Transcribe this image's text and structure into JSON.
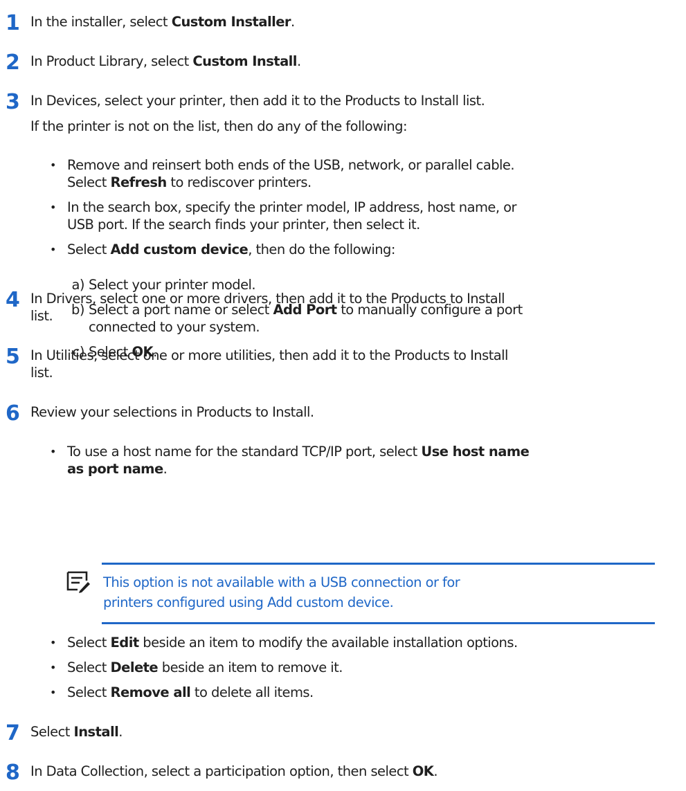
{
  "steps": [
    {
      "number": "1",
      "text": [
        "In the installer, select ",
        "Custom Installer",
        "."
      ]
    },
    {
      "number": "2",
      "text": [
        "In Product Library, select ",
        "Custom Install",
        "."
      ]
    },
    {
      "number": "3",
      "line1": "In Devices, select your printer, then add it to the Products to Install list.",
      "line2": "If the printer is not on the list, then do any of the following:",
      "bullets": [
        {
          "l1": "Remove and reinsert both ends of the USB, network, or parallel cable.",
          "l2": [
            "Select ",
            "Refresh",
            " to rediscover printers."
          ]
        },
        {
          "l1": "In the search box, specify the printer model, IP address, host name, or",
          "l2": "USB port. If the search finds your printer, then select it."
        },
        {
          "l1": [
            "Select ",
            "Add custom device",
            ", then do the following:"
          ]
        }
      ],
      "substeps": [
        {
          "label": "a)",
          "text": "Select your printer model."
        },
        {
          "label": "b)",
          "l1": [
            "Select a port name or select ",
            "Add Port",
            " to manually configure a port"
          ],
          "l2": "connected to your system."
        },
        {
          "label": "c)",
          "text": [
            "Select ",
            "OK",
            "."
          ]
        }
      ]
    },
    {
      "number": "4",
      "l1": "In Drivers, select one or more drivers, then add it to the Products to Install",
      "l2": "list."
    },
    {
      "number": "5",
      "l1": "In Utilities, select one or more utilities, then add it to the Products to Install",
      "l2": "list."
    },
    {
      "number": "6",
      "text": "Review your selections in Products to Install.",
      "bullets": [
        {
          "l1": [
            "To use a host name for the standard TCP/IP port, select ",
            "Use host name"
          ],
          "l2": [
            "as port name",
            "."
          ]
        },
        {
          "l1": [
            "Select ",
            "Edit",
            " beside an item to modify the available installation options."
          ]
        },
        {
          "l1": [
            "Select ",
            "Delete",
            " beside an item to remove it."
          ]
        },
        {
          "l1": [
            "Select ",
            "Remove all",
            " to delete all items."
          ]
        }
      ],
      "note": {
        "icon": "note-icon",
        "l1": "This option is not available with a USB connection or for",
        "l2": "printers configured using Add custom device."
      }
    },
    {
      "number": "7",
      "text": [
        "Select ",
        "Install",
        "."
      ]
    },
    {
      "number": "8",
      "text": [
        "In Data Collection, select a participation option, then select ",
        "OK",
        "."
      ]
    }
  ],
  "bullet_glyph": "•",
  "accent_color": "#1f67c7"
}
